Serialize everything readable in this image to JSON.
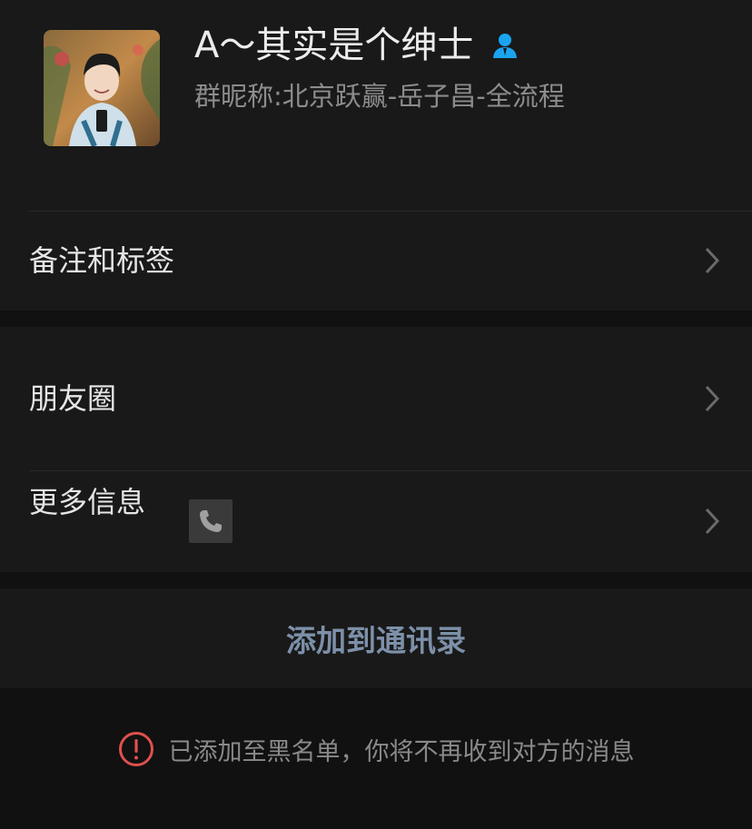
{
  "profile": {
    "name": "A～其实是个绅士",
    "nickname_label": "群昵称:",
    "nickname_value": "北京跃赢-岳子昌-全流程",
    "gender_icon": "male-user-icon",
    "gender_color": "#1aa4f0"
  },
  "rows": {
    "remark_label": "备注和标签",
    "moments_label": "朋友圈",
    "more_label": "更多信息"
  },
  "actions": {
    "add_contact_label": "添加到通讯录",
    "add_color": "#7d90a9"
  },
  "notice": {
    "text": "已添加至黑名单，你将不再收到对方的消息",
    "icon": "exclamation-circle-icon",
    "icon_color": "#e0504e"
  }
}
